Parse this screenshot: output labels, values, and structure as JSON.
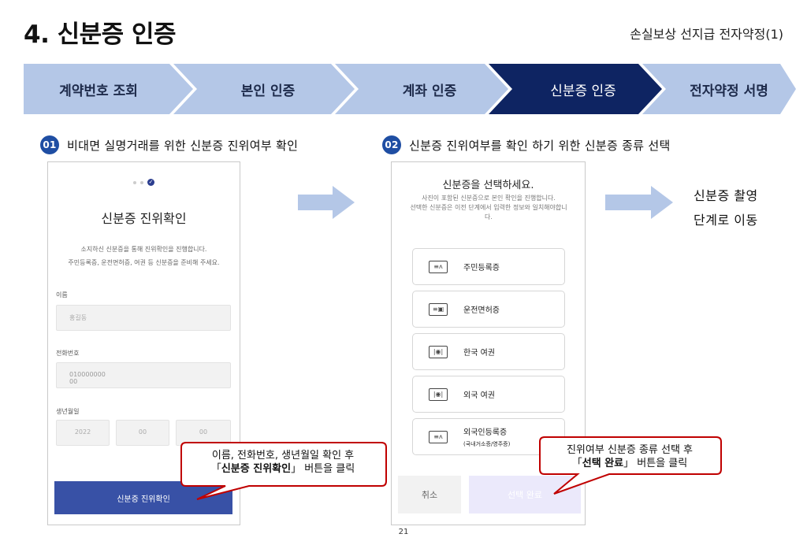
{
  "header": {
    "title": "4. 신분증 인증",
    "subtitle": "손실보상 선지급 전자약정(1)"
  },
  "steps": [
    {
      "label": "계약번호 조회",
      "active": false
    },
    {
      "label": "본인 인증",
      "active": false
    },
    {
      "label": "계좌 인증",
      "active": false
    },
    {
      "label": "신분증 인증",
      "active": true
    },
    {
      "label": "전자약정 서명",
      "active": false
    }
  ],
  "colors": {
    "step_bg": "#b4c7e7",
    "step_active_bg": "#0e2462",
    "accent": "#3851a6",
    "callout_border": "#c00000"
  },
  "notes": {
    "n1": {
      "badge": "01",
      "text": "비대면 실명거래를 위한 신분증 진위여부 확인"
    },
    "n2": {
      "badge": "02",
      "text": "신분증 진위여부를 확인 하기 위한 신분증 종류 선택"
    }
  },
  "screen1": {
    "title": "신분증 진위확인",
    "desc1": "소지하신 신분증을 통해 진위확인을 진행합니다.",
    "desc2": "주민등록증, 운전면허증, 여권 등 신분증을 준비해 주세요.",
    "name_label": "이름",
    "name_value": "홍길동",
    "phone_label": "전화번호",
    "phone_value1": "010000000",
    "phone_value2": "00",
    "birth_label": "생년월일",
    "birth_year": "2022",
    "birth_month": "00",
    "birth_day": "00",
    "button": "신분증 진위확인"
  },
  "screen2": {
    "title": "신분증을 선택하세요.",
    "desc1": "사진이 포함된 신분증으로 본인 확인을 진행합니다.",
    "desc2": "선택한 신분증은 이전 단계에서 입력한 정보와 일치해야합니",
    "desc3": "다.",
    "ids": [
      {
        "name": "주민등록증",
        "icon": "id-card-icon"
      },
      {
        "name": "운전면허증",
        "icon": "driver-license-icon"
      },
      {
        "name": "한국 여권",
        "icon": "passport-icon"
      },
      {
        "name": "외국 여권",
        "icon": "passport-icon"
      },
      {
        "name": "외국인등록증",
        "sub": "(국내거소증/영주증)",
        "icon": "alien-card-icon"
      }
    ],
    "cancel": "취소",
    "done": "선택 완료"
  },
  "right_note": {
    "line1": "신분증 촬영",
    "line2": "단계로 이동"
  },
  "callouts": {
    "c1": {
      "line1": "이름, 전화번호, 생년월일 확인 후",
      "open": "「",
      "bold": "신분증 진위확인",
      "close": "」",
      "tail": " 버튼을 클릭"
    },
    "c2": {
      "line1": "진위여부 신분증 종류 선택 후",
      "open": "「",
      "bold": "선택 완료",
      "close": "」",
      "tail": " 버튼을 클릭"
    }
  },
  "page_number": "21"
}
